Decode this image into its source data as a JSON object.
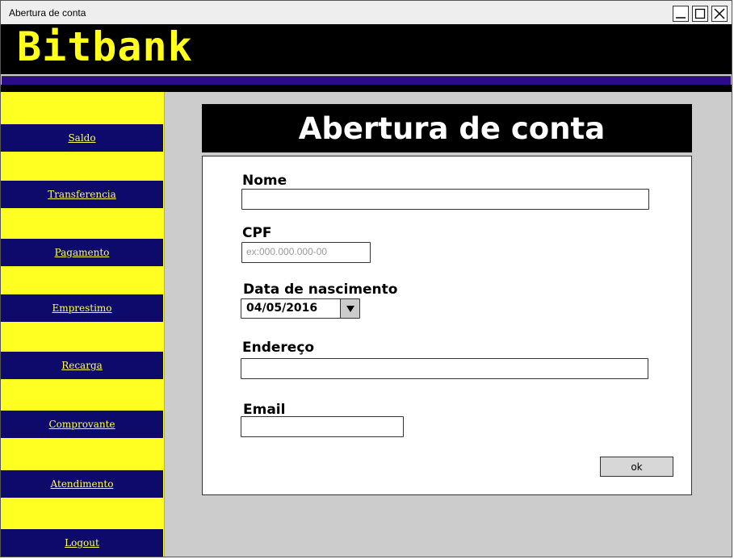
{
  "window": {
    "title": "Abertura de conta"
  },
  "brand": {
    "logo_text": "Bitbank",
    "accent": "#ffff1a",
    "nav_color": "#0d0a6b"
  },
  "sidebar": {
    "items": [
      {
        "label": "Saldo"
      },
      {
        "label": "Transferencia"
      },
      {
        "label": "Pagamento"
      },
      {
        "label": "Emprestimo"
      },
      {
        "label": "Recarga"
      },
      {
        "label": "Comprovante"
      },
      {
        "label": "Atendimento"
      },
      {
        "label": "Logout"
      }
    ]
  },
  "form": {
    "heading": "Abertura de conta",
    "nome": {
      "label": "Nome",
      "value": ""
    },
    "cpf": {
      "label": "CPF",
      "value": "",
      "placeholder": "ex:000.000.000-00"
    },
    "nascimento": {
      "label": "Data de nascimento",
      "value": "04/05/2016"
    },
    "endereco": {
      "label": "Endereço",
      "value": ""
    },
    "email": {
      "label": "Email",
      "value": ""
    },
    "submit_label": "ok"
  }
}
